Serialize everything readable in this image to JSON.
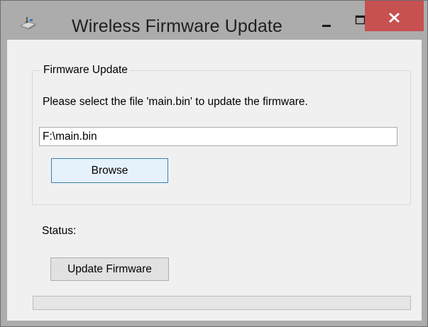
{
  "window": {
    "title": "Wireless Firmware Update",
    "icon": "app-icon",
    "controls": {
      "minimize_icon": "minimize-icon",
      "maximize_icon": "maximize-icon",
      "close_icon": "close-icon"
    },
    "colors": {
      "titlebar": "#acacac",
      "close_button": "#c75050",
      "client": "#f0f0f0"
    }
  },
  "group": {
    "title": "Firmware Update",
    "instruction": "Please select the file 'main.bin' to update the firmware.",
    "file_path": "F:\\main.bin",
    "browse_label": "Browse"
  },
  "status": {
    "label": "Status:",
    "update_label": "Update Firmware",
    "progress_percent": 0
  }
}
